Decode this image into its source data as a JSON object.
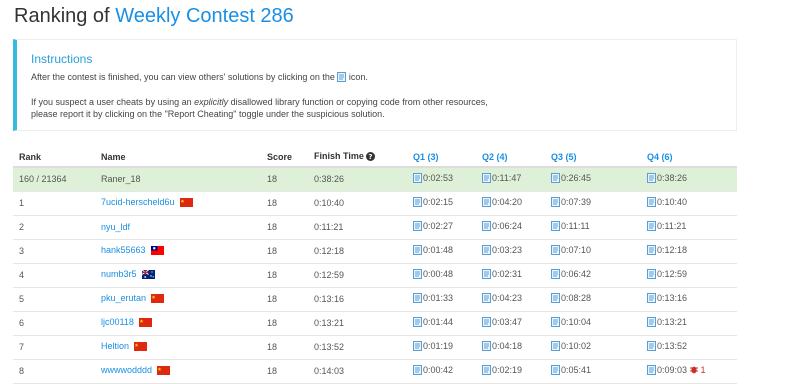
{
  "header": {
    "title_prefix": "Ranking of",
    "contest_name": "Weekly Contest 286"
  },
  "instructions": {
    "title": "Instructions",
    "line1_before": "After the contest is finished, you can view others' solutions by clicking on the",
    "line1_after": "icon.",
    "line2_before": "If you suspect a user cheats by using an",
    "line2_em": "explicitly",
    "line2_after": "disallowed library function or copying code from other resources,",
    "line3": "please report it by clicking on the \"Report Cheating\" toggle under the suspicious solution."
  },
  "table": {
    "columns": {
      "rank": "Rank",
      "name": "Name",
      "score": "Score",
      "finish": "Finish Time",
      "q1": "Q1 (3)",
      "q2": "Q2 (4)",
      "q3": "Q3 (5)",
      "q4": "Q4 (6)"
    },
    "rows": [
      {
        "rank": "160 / 21364",
        "name": "Raner_18",
        "flag": "",
        "score": "18",
        "finish": "0:38:26",
        "q1": "0:02:53",
        "q2": "0:11:47",
        "q3": "0:26:45",
        "q4": "0:38:26",
        "q4_extra": ""
      },
      {
        "rank": "1",
        "name": "7ucid-herscheld6u",
        "flag": "cn",
        "score": "18",
        "finish": "0:10:40",
        "q1": "0:02:15",
        "q2": "0:04:20",
        "q3": "0:07:39",
        "q4": "0:10:40",
        "q4_extra": ""
      },
      {
        "rank": "2",
        "name": "nyu_ldf",
        "flag": "",
        "score": "18",
        "finish": "0:11:21",
        "q1": "0:02:27",
        "q2": "0:06:24",
        "q3": "0:11:11",
        "q4": "0:11:21",
        "q4_extra": ""
      },
      {
        "rank": "3",
        "name": "hank55663",
        "flag": "tw",
        "score": "18",
        "finish": "0:12:18",
        "q1": "0:01:48",
        "q2": "0:03:23",
        "q3": "0:07:10",
        "q4": "0:12:18",
        "q4_extra": ""
      },
      {
        "rank": "4",
        "name": "numb3r5",
        "flag": "au",
        "score": "18",
        "finish": "0:12:59",
        "q1": "0:00:48",
        "q2": "0:02:31",
        "q3": "0:06:42",
        "q4": "0:12:59",
        "q4_extra": ""
      },
      {
        "rank": "5",
        "name": "pku_erutan",
        "flag": "cn",
        "score": "18",
        "finish": "0:13:16",
        "q1": "0:01:33",
        "q2": "0:04:23",
        "q3": "0:08:28",
        "q4": "0:13:16",
        "q4_extra": ""
      },
      {
        "rank": "6",
        "name": "ljc00118",
        "flag": "cn",
        "score": "18",
        "finish": "0:13:21",
        "q1": "0:01:44",
        "q2": "0:03:47",
        "q3": "0:10:04",
        "q4": "0:13:21",
        "q4_extra": ""
      },
      {
        "rank": "7",
        "name": "Heltion",
        "flag": "cn",
        "score": "18",
        "finish": "0:13:52",
        "q1": "0:01:19",
        "q2": "0:04:18",
        "q3": "0:10:02",
        "q4": "0:13:52",
        "q4_extra": ""
      },
      {
        "rank": "8",
        "name": "wwwwodddd",
        "flag": "cn",
        "score": "18",
        "finish": "0:14:03",
        "q1": "0:00:42",
        "q2": "0:02:19",
        "q3": "0:05:41",
        "q4": "0:09:03",
        "q4_extra": "1"
      }
    ]
  },
  "icons": {
    "solution": "document-icon",
    "help": "question-circle-icon",
    "wrong_attempt": "bug-icon"
  },
  "colors": {
    "link": "#1a8fe3",
    "accent_border": "#39b8e0",
    "highlight_row": "#dff0d8",
    "bug": "#c9302c"
  }
}
